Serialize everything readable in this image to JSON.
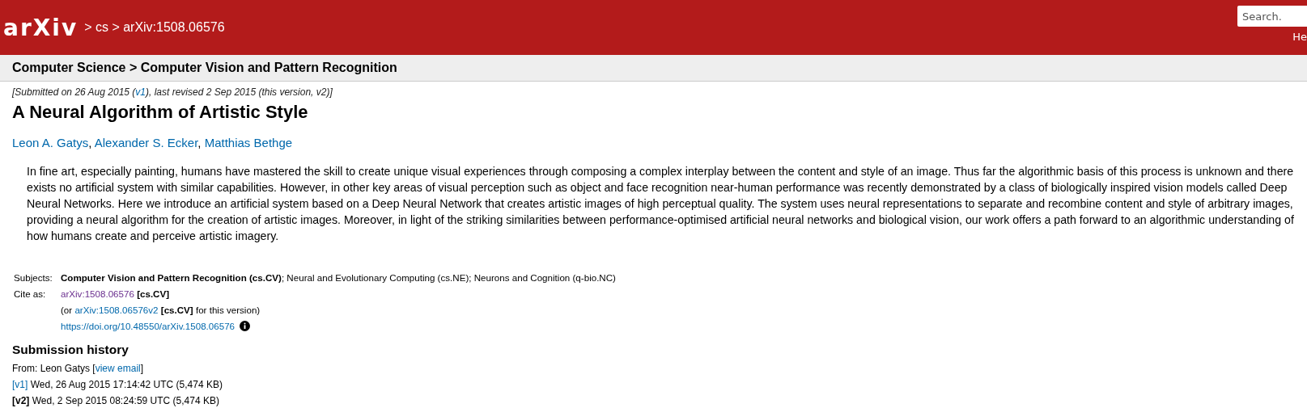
{
  "header": {
    "logo": "arXiv",
    "breadcrumb": "> cs > arXiv:1508.06576",
    "search": {
      "placeholder": "Search."
    },
    "help_link": "He"
  },
  "category_bar": "Computer Science > Computer Vision and Pattern Recognition",
  "submitted": [
    {
      "kind": "text",
      "text": "[Submitted on 26 Aug 2015 ("
    },
    {
      "kind": "link",
      "text": "v1"
    },
    {
      "kind": "text",
      "text": "), last revised 2 Sep 2015 (this version, v2)]"
    }
  ],
  "title": "A Neural Algorithm of Artistic Style",
  "authors": [
    {
      "kind": "link",
      "text": "Leon A. Gatys"
    },
    {
      "kind": "text",
      "text": ", "
    },
    {
      "kind": "link",
      "text": "Alexander S. Ecker"
    },
    {
      "kind": "text",
      "text": ", "
    },
    {
      "kind": "link",
      "text": "Matthias Bethge"
    }
  ],
  "abstract": "In fine art, especially painting, humans have mastered the skill to create unique visual experiences through composing a complex interplay between the content and style of an image. Thus far the algorithmic basis of this process is unknown and there exists no artificial system with similar capabilities. However, in other key areas of visual perception such as object and face recognition near-human performance was recently demonstrated by a class of biologically inspired vision models called Deep Neural Networks. Here we introduce an artificial system based on a Deep Neural Network that creates artistic images of high perceptual quality. The system uses neural representations to separate and recombine content and style of arbitrary images, providing a neural algorithm for the creation of artistic images. Moreover, in light of the striking similarities between performance-optimised artificial neural networks and biological vision, our work offers a path forward to an algorithmic understanding of how humans create and perceive artistic imagery.",
  "metadata": [
    {
      "label": "Subjects:",
      "lines": [
        [
          {
            "kind": "bold",
            "text": "Computer Vision and Pattern Recognition (cs.CV)"
          },
          {
            "kind": "text",
            "text": "; Neural and Evolutionary Computing (cs.NE); Neurons and Cognition (q-bio.NC)"
          }
        ]
      ]
    },
    {
      "label": "Cite as:",
      "lines": [
        [
          {
            "kind": "visited",
            "text": "arXiv:1508.06576"
          },
          {
            "kind": "space"
          },
          {
            "kind": "bold",
            "text": "[cs.CV]"
          }
        ],
        [
          {
            "kind": "text",
            "text": "(or "
          },
          {
            "kind": "link",
            "text": "arXiv:1508.06576v2"
          },
          {
            "kind": "space"
          },
          {
            "kind": "bold",
            "text": "[cs.CV]"
          },
          {
            "kind": "text",
            "text": " for this version)"
          }
        ],
        [
          {
            "kind": "link",
            "text": "https://doi.org/10.48550/arXiv.1508.06576"
          },
          {
            "kind": "info"
          }
        ]
      ]
    }
  ],
  "history": {
    "heading": "Submission history",
    "lines": [
      [
        {
          "kind": "text",
          "text": "From: Leon Gatys ["
        },
        {
          "kind": "link",
          "text": "view email"
        },
        {
          "kind": "text",
          "text": "]"
        }
      ],
      [
        {
          "kind": "link",
          "text": "[v1]"
        },
        {
          "kind": "text",
          "text": " Wed, 26 Aug 2015 17:14:42 UTC (5,474 KB)"
        }
      ],
      [
        {
          "kind": "bold",
          "text": "[v2]"
        },
        {
          "kind": "text",
          "text": " Wed, 2 Sep 2015 08:24:59 UTC (5,474 KB)"
        }
      ]
    ]
  }
}
